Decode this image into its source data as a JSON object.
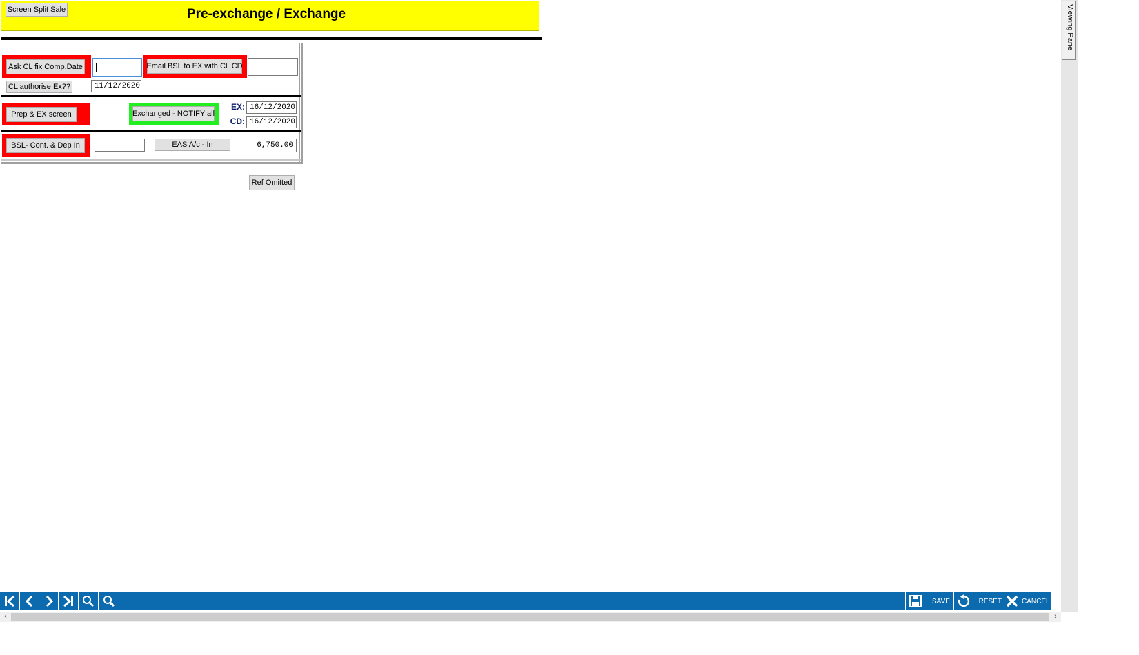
{
  "header": {
    "title": "Pre-exchange / Exchange",
    "split_button": "Screen Split Sale",
    "background_color": "#ffff00"
  },
  "section1": {
    "ask_button": "Ask CL fix Comp.Date",
    "ask_input_value": "",
    "email_button": "Email BSL to EX with CL CD",
    "email_input_value": "",
    "authorise_button": "CL authorise Ex??",
    "authorise_date": "11/12/2020"
  },
  "section2": {
    "prep_button": "Prep & EX screen",
    "exchanged_button": "Exchanged - NOTIFY all",
    "ex_label": "EX:",
    "ex_date": "16/12/2020",
    "cd_label": "CD:",
    "cd_date": "16/12/2020"
  },
  "section3": {
    "bsl_button": "BSL- Cont. & Dep In",
    "bsl_input_value": "",
    "eas_button": "EAS A/c - In",
    "eas_value": "6,750.00"
  },
  "ref_omitted_button": "Ref Omitted",
  "side_tab": "Viewing Pane",
  "footer": {
    "nav_icons": [
      "first-record-icon",
      "previous-record-icon",
      "next-record-icon",
      "last-record-icon",
      "search-icon",
      "search-user-icon"
    ],
    "save_label": "SAVE",
    "reset_label": "RESET",
    "cancel_label": "CANCEL",
    "bar_color": "#0c6aae"
  },
  "colors": {
    "alert_red": "#ff0000",
    "success_green": "#22ee22",
    "label_blue": "#0b1f6b"
  }
}
